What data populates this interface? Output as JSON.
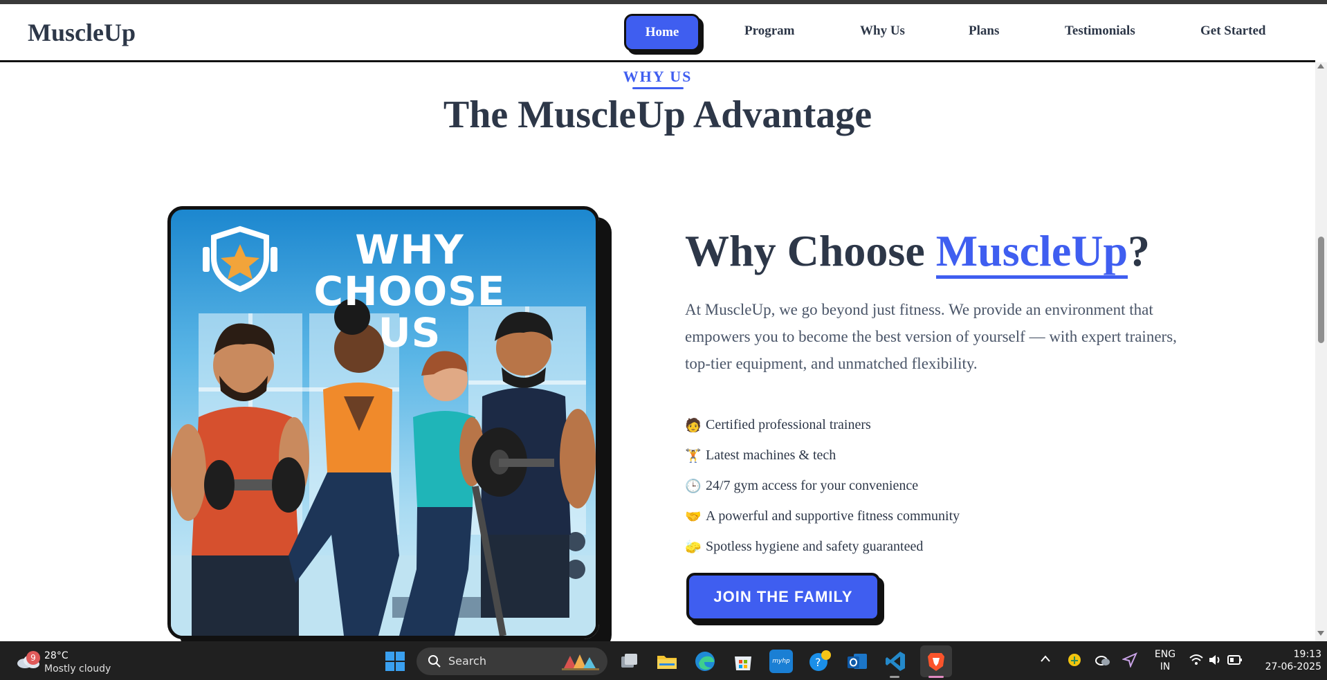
{
  "header": {
    "brand": "MuscleUp",
    "nav": [
      {
        "label": "Home",
        "active": true
      },
      {
        "label": "Program"
      },
      {
        "label": "Why Us"
      },
      {
        "label": "Plans"
      },
      {
        "label": "Testimonials"
      },
      {
        "label": "Get Started"
      }
    ]
  },
  "section": {
    "tag": "WHY US",
    "title": "The MuscleUp Advantage"
  },
  "image_card": {
    "title_line1": "WHY CHOOSE",
    "title_line2": "US"
  },
  "content": {
    "heading_prefix": "Why Choose ",
    "heading_accent": "MuscleUp",
    "heading_suffix": "?",
    "description": "At MuscleUp, we go beyond just fitness. We provide an environment that empowers you to become the best version of yourself — with expert trainers, top-tier equipment, and unmatched flexibility.",
    "features": [
      {
        "icon": "trainer-icon",
        "glyph": "🧑",
        "text": "Certified professional trainers"
      },
      {
        "icon": "weightlifter-icon",
        "glyph": "🏋",
        "text": "Latest machines & tech"
      },
      {
        "icon": "clock-icon",
        "glyph": "🕒",
        "text": "24/7 gym access for your convenience"
      },
      {
        "icon": "handshake-icon",
        "glyph": "🤝",
        "text": "A powerful and supportive fitness community"
      },
      {
        "icon": "sponge-icon",
        "glyph": "🧽",
        "text": "Spotless hygiene and safety guaranteed"
      }
    ],
    "cta": "JOIN THE FAMILY"
  },
  "colors": {
    "accent": "#3f5ef0",
    "text_dark": "#2d3748",
    "outline": "#111111"
  },
  "taskbar": {
    "weather_badge": "9",
    "weather_temp": "28°C",
    "weather_condition": "Mostly cloudy",
    "search_label": "Search",
    "apps": [
      "task-view-icon",
      "file-explorer-icon",
      "edge-browser-icon",
      "store-icon",
      "myhp-icon",
      "help-icon",
      "outlook-icon",
      "vscode-icon",
      "brave-browser-icon"
    ],
    "myhp_label": "myhp",
    "lang_line1": "ENG",
    "lang_line2": "IN",
    "time": "19:13",
    "date": "27-06-2025"
  }
}
